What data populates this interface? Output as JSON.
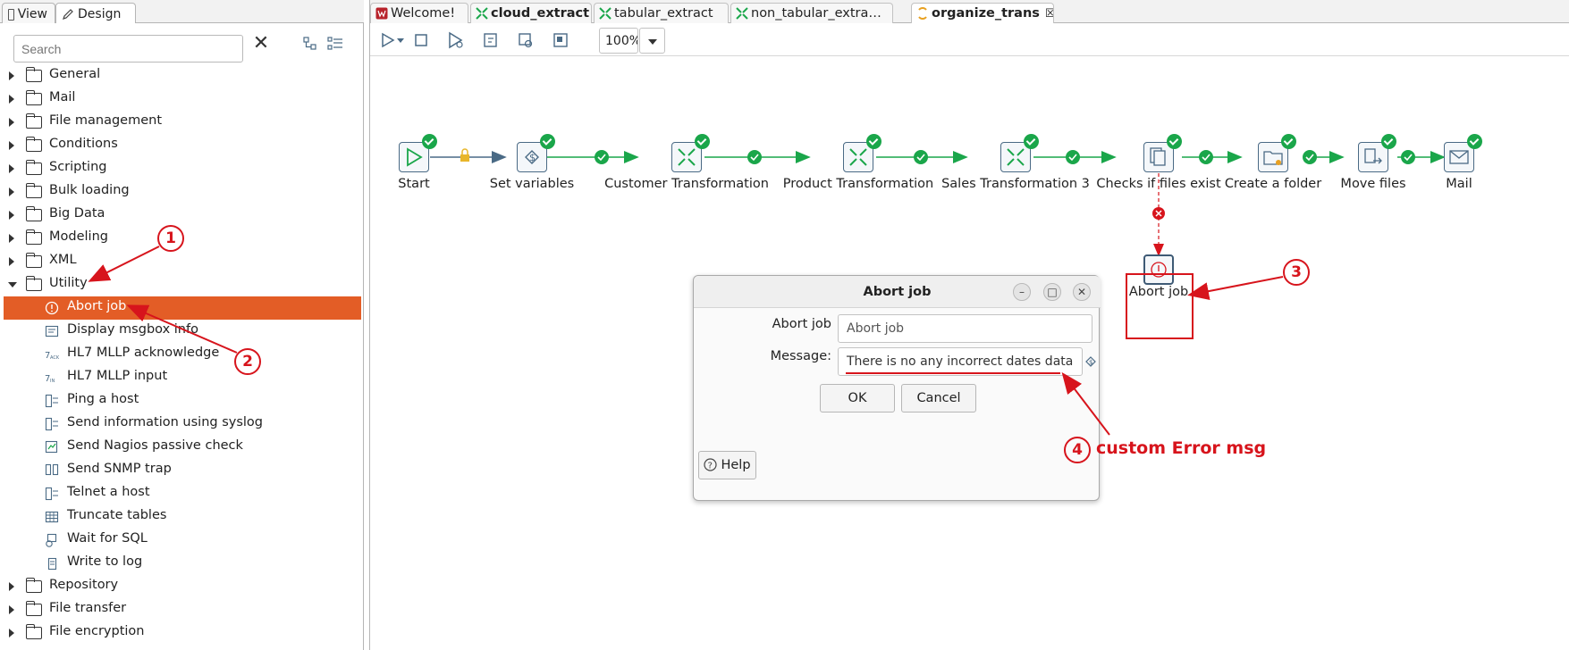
{
  "left_panel": {
    "tabs": [
      {
        "label": "View",
        "icon": "view-icon"
      },
      {
        "label": "Design",
        "icon": "pencil-icon"
      }
    ],
    "search": {
      "placeholder": "Search",
      "value": ""
    },
    "tree": [
      {
        "label": "General",
        "expanded": false
      },
      {
        "label": "Mail",
        "expanded": false
      },
      {
        "label": "File management",
        "expanded": false
      },
      {
        "label": "Conditions",
        "expanded": false
      },
      {
        "label": "Scripting",
        "expanded": false
      },
      {
        "label": "Bulk loading",
        "expanded": false
      },
      {
        "label": "Big Data",
        "expanded": false
      },
      {
        "label": "Modeling",
        "expanded": false
      },
      {
        "label": "XML",
        "expanded": false
      },
      {
        "label": "Utility",
        "expanded": true
      }
    ],
    "utility_items": [
      {
        "label": "Abort job",
        "icon": "abort-icon",
        "selected": true
      },
      {
        "label": "Display msgbox info",
        "icon": "msgbox-icon"
      },
      {
        "label": "HL7 MLLP acknowledge",
        "icon": "hl7-ack-icon"
      },
      {
        "label": "HL7 MLLP input",
        "icon": "hl7-input-icon"
      },
      {
        "label": "Ping a host",
        "icon": "ping-icon"
      },
      {
        "label": "Send information using syslog",
        "icon": "syslog-icon"
      },
      {
        "label": "Send Nagios passive check",
        "icon": "nagios-icon"
      },
      {
        "label": "Send SNMP trap",
        "icon": "snmp-icon"
      },
      {
        "label": "Telnet a host",
        "icon": "telnet-icon"
      },
      {
        "label": "Truncate tables",
        "icon": "table-icon"
      },
      {
        "label": "Wait for SQL",
        "icon": "wait-sql-icon"
      },
      {
        "label": "Write to log",
        "icon": "log-icon"
      }
    ],
    "tree_after": [
      {
        "label": "Repository",
        "expanded": false
      },
      {
        "label": "File transfer",
        "expanded": false
      },
      {
        "label": "File encryption",
        "expanded": false
      }
    ]
  },
  "editor_tabs": [
    {
      "label": "Welcome!",
      "icon": "welcome-icon",
      "active": false
    },
    {
      "label": "cloud_extract",
      "icon": "transform-icon",
      "active": false,
      "bold": true
    },
    {
      "label": "tabular_extract",
      "icon": "transform-icon",
      "active": false
    },
    {
      "label": "non_tabular_extra…",
      "icon": "transform-icon",
      "active": false
    },
    {
      "label": "organize_trans",
      "icon": "job-icon",
      "active": true
    }
  ],
  "toolbar": {
    "zoom": "100%"
  },
  "flow": {
    "nodes": [
      {
        "label": "Start",
        "icon": "start-icon"
      },
      {
        "label": "Set variables",
        "icon": "variables-icon"
      },
      {
        "label": "Customer Transformation",
        "icon": "transformation-icon"
      },
      {
        "label": "Product Transformation",
        "icon": "transformation-icon"
      },
      {
        "label": "Sales Transformation 3",
        "icon": "transformation-icon"
      },
      {
        "label": "Checks if files exist",
        "icon": "files-exist-icon"
      },
      {
        "label": "Create a folder",
        "icon": "folder-icon"
      },
      {
        "label": "Move files",
        "icon": "move-files-icon"
      },
      {
        "label": "Mail",
        "icon": "mail-icon"
      },
      {
        "label": "Abort job",
        "icon": "abort-icon"
      }
    ]
  },
  "dialog": {
    "title": "Abort job",
    "name_label": "Abort job",
    "name_value": "Abort job",
    "message_label": "Message:",
    "message_value": "There is no any incorrect dates data",
    "ok": "OK",
    "cancel": "Cancel",
    "help": "Help"
  },
  "annotations": {
    "n1": "1",
    "n2": "2",
    "n3": "3",
    "n4": "4",
    "note": "custom Error msg",
    "color": "#d7141c"
  },
  "colors": {
    "selected_row": "#e35d26",
    "hop_green": "#1aa64a",
    "error_red": "#d7141c"
  }
}
